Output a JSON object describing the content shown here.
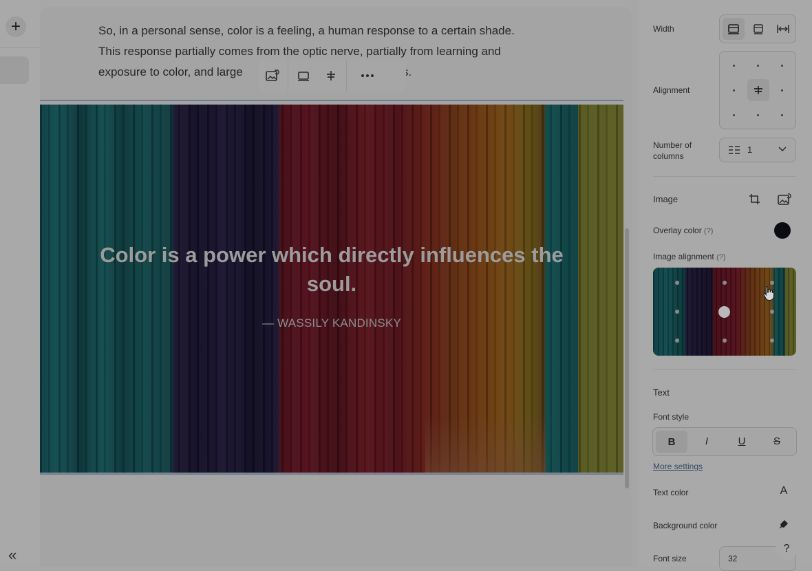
{
  "editor": {
    "paragraph_lines": [
      "So, in a personal sense, color is a feeling, a human response to a certain shade.",
      "This response partially comes from the optic nerve, partially from learning and",
      "exposure to color, and large"
    ],
    "paragraph_tail": "s.",
    "quote": "Color is a power which directly influences the soul.",
    "author": "— WASSILY KANDINSKY"
  },
  "rail": {
    "plus_icon": "+",
    "collapse_icon": "«"
  },
  "panel": {
    "width_label": "Width",
    "alignment_label": "Alignment",
    "columns_label": "Number of columns",
    "columns_value": "1",
    "image_label": "Image",
    "overlay_color_label": "Overlay color",
    "overlay_color": "#0b0b12",
    "image_alignment_label": "Image alignment",
    "help_mark": "(?)",
    "text_label": "Text",
    "font_style_label": "Font style",
    "font_style_buttons": [
      "B",
      "I",
      "U",
      "S"
    ],
    "more_settings": "More settings",
    "text_color_label": "Text color",
    "text_color_icon": "A",
    "background_color_label": "Background color",
    "font_size_label": "Font size",
    "font_size_value": "32",
    "help_button": "?"
  }
}
